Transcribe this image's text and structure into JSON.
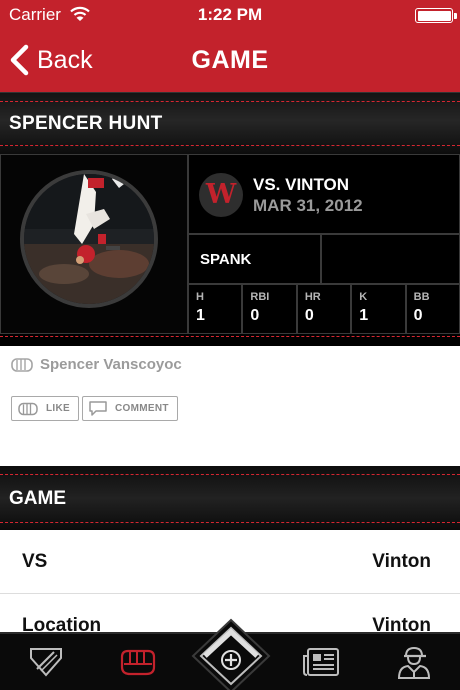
{
  "status_bar": {
    "carrier": "Carrier",
    "time": "1:22 PM"
  },
  "nav": {
    "back_label": "Back",
    "title": "GAME"
  },
  "player": {
    "name": "SPENCER HUNT"
  },
  "game_card": {
    "result": "W",
    "opponent": "VS. VINTON",
    "date": "MAR 31, 2012",
    "nickname": "SPANK",
    "stats": [
      {
        "label": "H",
        "value": "1"
      },
      {
        "label": "RBI",
        "value": "0"
      },
      {
        "label": "HR",
        "value": "0"
      },
      {
        "label": "K",
        "value": "1"
      },
      {
        "label": "BB",
        "value": "0"
      }
    ]
  },
  "social": {
    "author": "Spencer Vanscoyoc",
    "like_label": "LIKE",
    "comment_label": "COMMENT"
  },
  "game_section": {
    "title": "GAME",
    "rows": [
      {
        "label": "VS",
        "value": "Vinton"
      },
      {
        "label": "Location",
        "value": "Vinton"
      }
    ]
  },
  "tab_bar": {
    "tabs": [
      {
        "icon": "baseball-diamond-icon"
      },
      {
        "icon": "fist-icon",
        "selected": true
      },
      {
        "icon": "home-plate-add-icon"
      },
      {
        "icon": "newspaper-icon"
      },
      {
        "icon": "player-profile-icon"
      }
    ]
  },
  "colors": {
    "brand_red": "#c3222c",
    "stitch_red": "#d62631",
    "background_dark": "#000000",
    "tab_bar": "#0a0a0a"
  }
}
